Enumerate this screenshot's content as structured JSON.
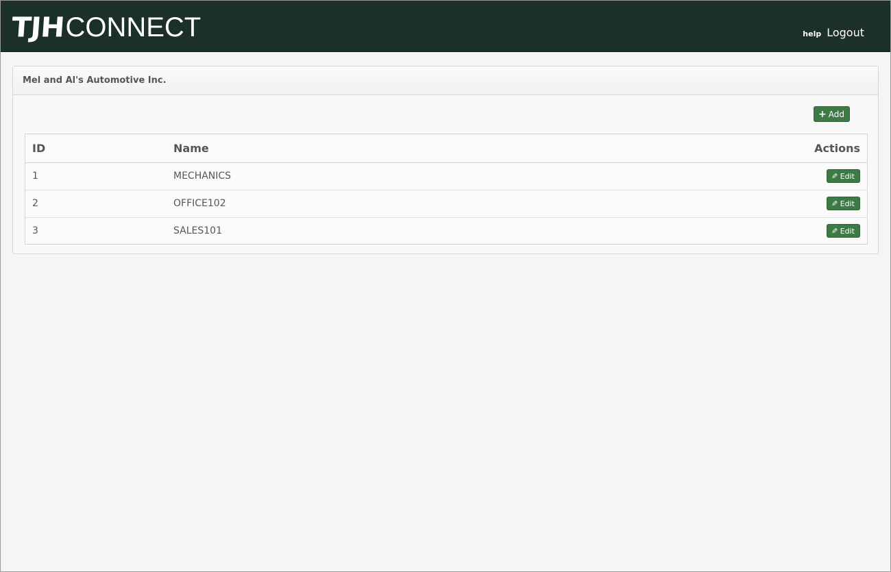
{
  "header": {
    "brand_strong": "TJH",
    "brand_light": "CONNECT",
    "help_label": "help",
    "logout_label": "Logout",
    "background_color": "#1a3029"
  },
  "panel": {
    "title": "Mel and Al's Automotive Inc.",
    "add_label": "Add",
    "add_icon": "plus-icon"
  },
  "table": {
    "columns": [
      "ID",
      "Name",
      "Actions"
    ],
    "rows": [
      {
        "id": "1",
        "name": "MECHANICS",
        "action_label": "Edit"
      },
      {
        "id": "2",
        "name": "OFFICE102",
        "action_label": "Edit"
      },
      {
        "id": "3",
        "name": "SALES101",
        "action_label": "Edit"
      }
    ],
    "action_icon": "pencil-icon"
  },
  "colors": {
    "button_green": "#3d7a45",
    "page_background": "#f5f5f5"
  }
}
